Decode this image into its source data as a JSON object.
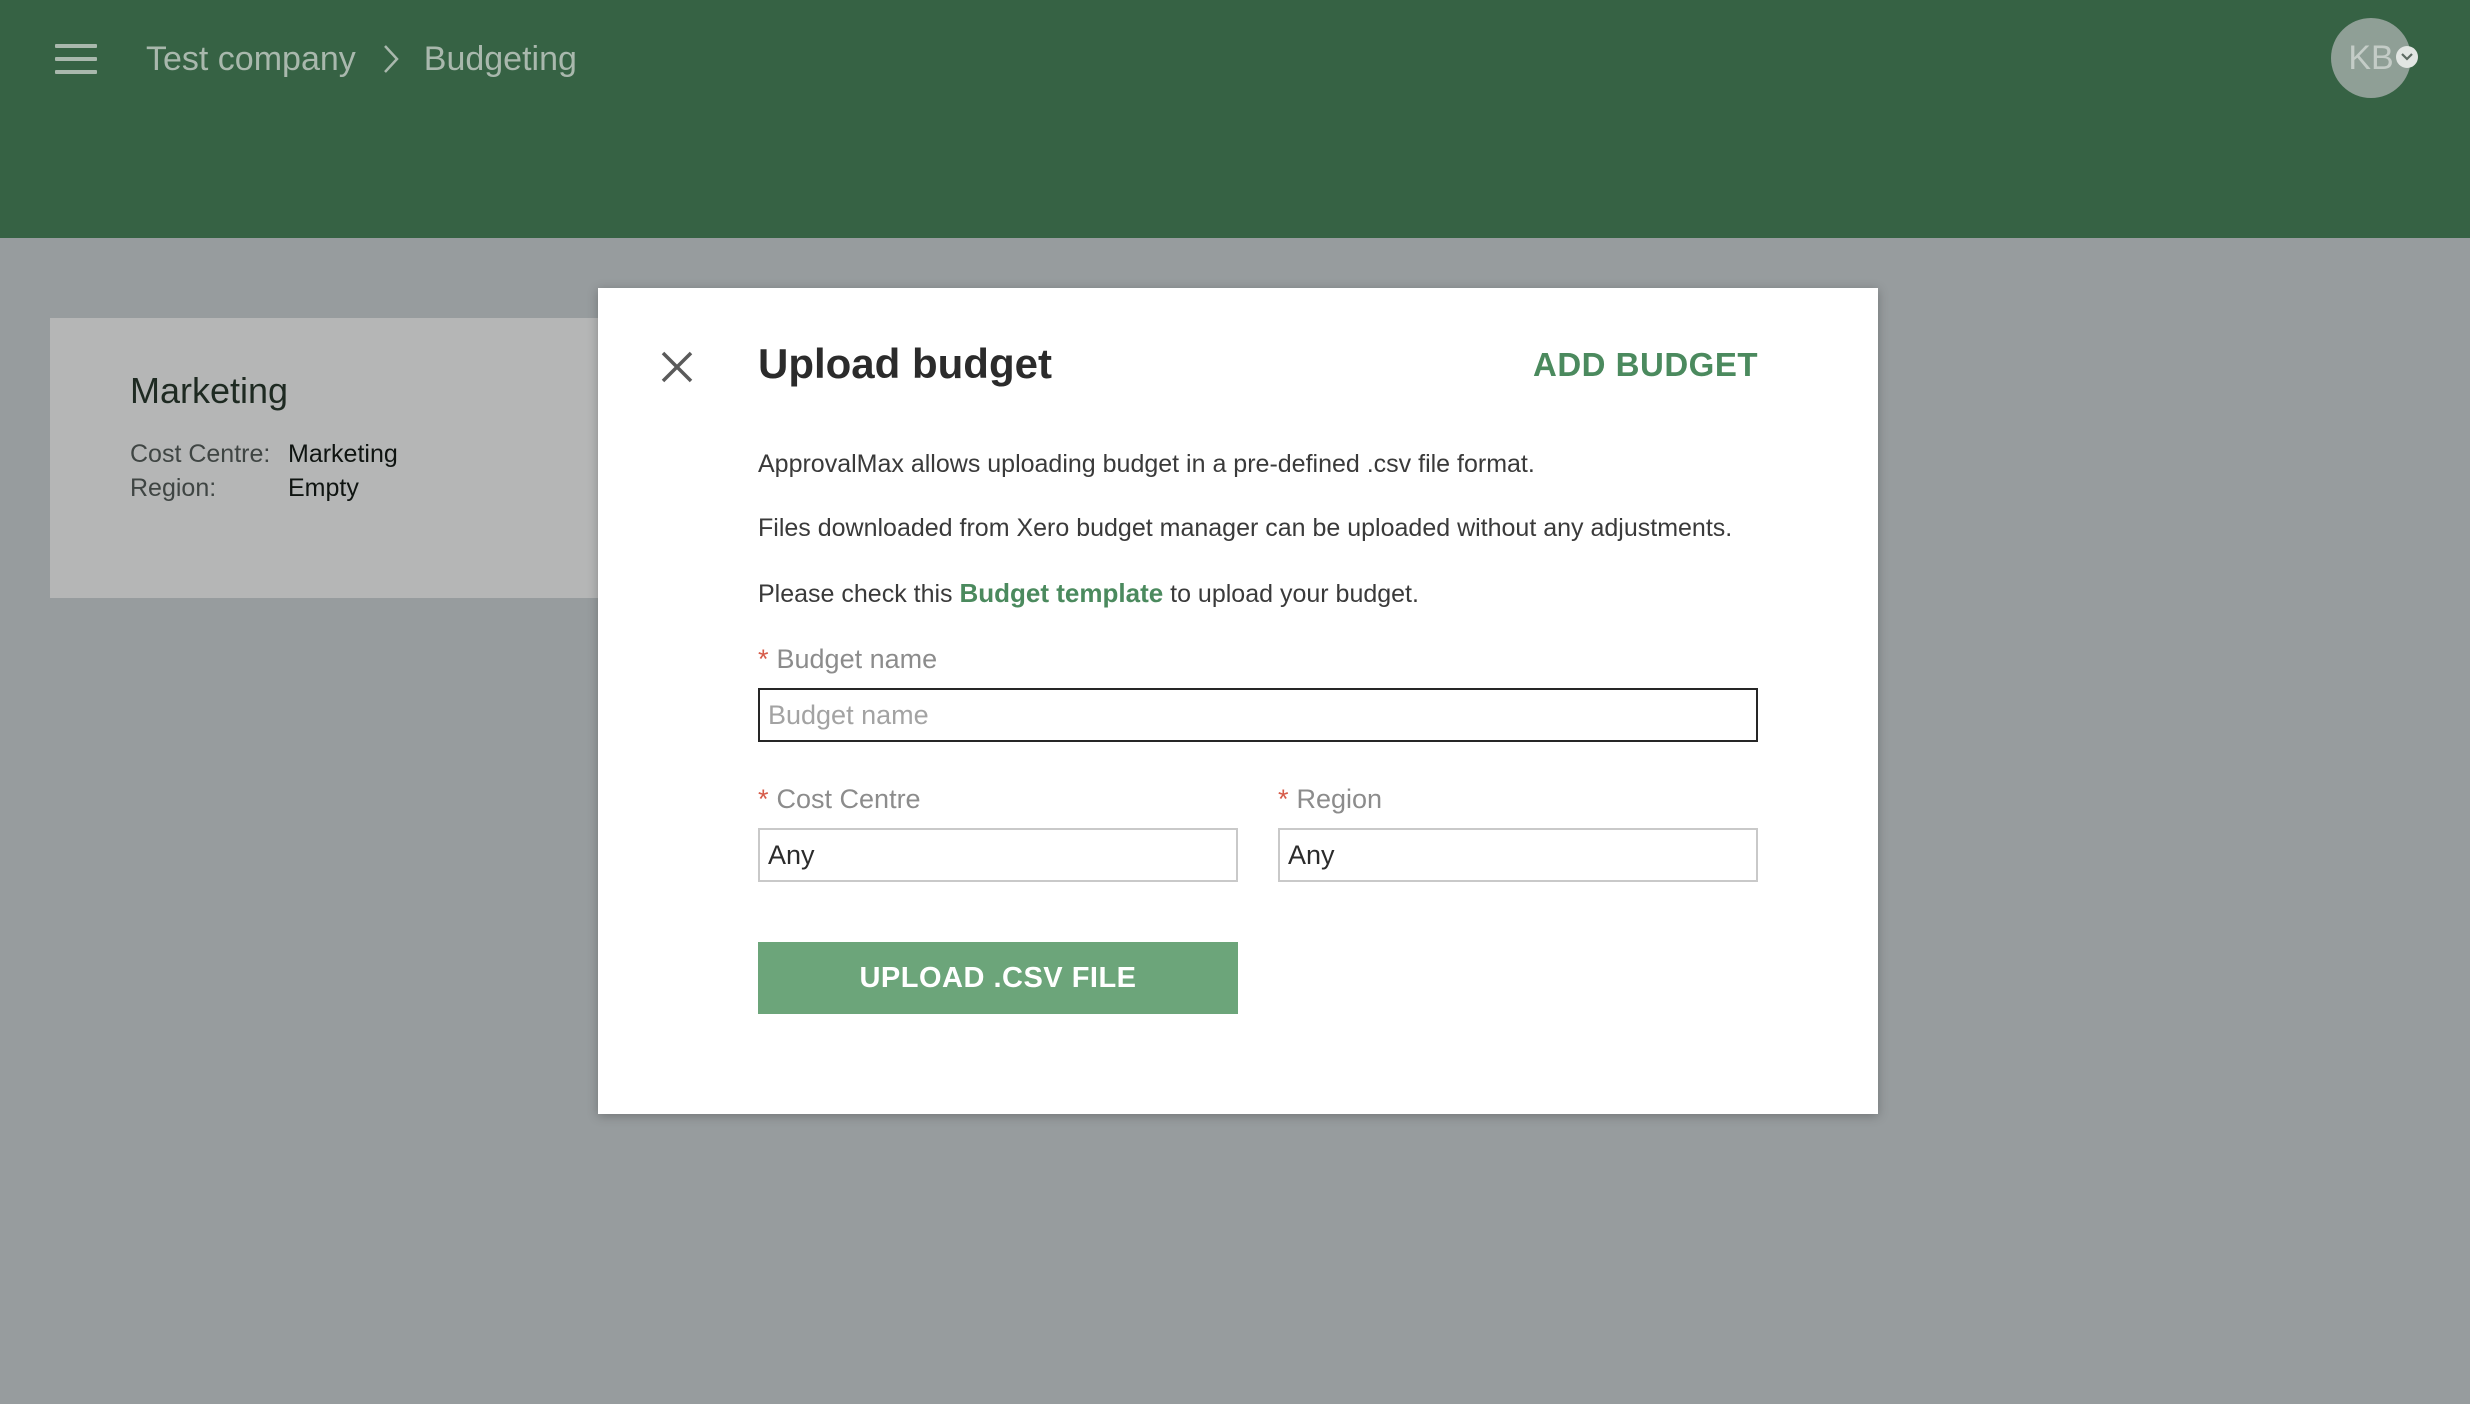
{
  "header": {
    "breadcrumb": [
      "Test company",
      "Budgeting"
    ],
    "avatar_initials": "KB"
  },
  "card": {
    "title": "Marketing",
    "rows": [
      {
        "key": "Cost Centre:",
        "value": "Marketing"
      },
      {
        "key": "Region:",
        "value": "Empty"
      }
    ]
  },
  "modal": {
    "title": "Upload budget",
    "add_budget_label": "ADD BUDGET",
    "info_1": "ApprovalMax allows uploading budget in a pre-defined .csv file format.",
    "info_2": "Files downloaded from Xero budget manager can be uploaded without any adjustments.",
    "info_3_prefix": "Please check this",
    "info_3_link": "Budget template",
    "info_3_suffix": "to upload your budget.",
    "required_marker": "*",
    "budget_name_label": "Budget name",
    "budget_name_placeholder": "Budget name",
    "cost_centre_label": "Cost Centre",
    "cost_centre_value": "Any",
    "region_label": "Region",
    "region_value": "Any",
    "upload_label": "UPLOAD .CSV FILE"
  },
  "colors": {
    "header": "#366244",
    "accent": "#4b8a5e",
    "button": "#6ca57a",
    "required": "#d65c4a",
    "overlay": "#979c9e"
  }
}
